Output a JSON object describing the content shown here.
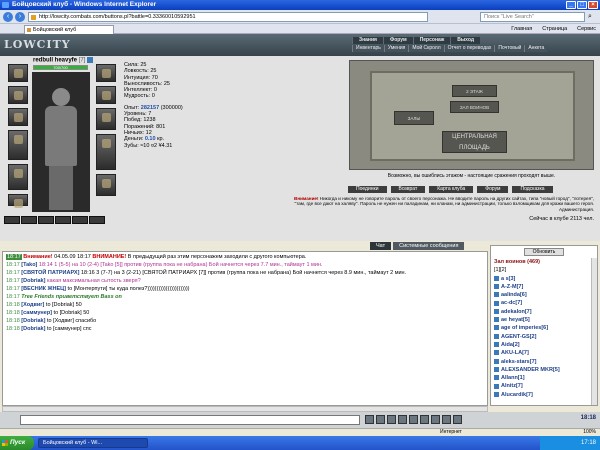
{
  "window": {
    "title": "Бойцовский клуб - Windows Internet Explorer"
  },
  "address": {
    "url": "http://lowcity.combats.com/buttons.pl?battle=0.33360010592951",
    "search_placeholder": "Поиск \"Live Search\""
  },
  "tab": {
    "title": "Бойцовский клуб"
  },
  "toolbar": {
    "home": "Главная",
    "page": "Страница",
    "service": "Сервис"
  },
  "game": {
    "logo": "LOWCITY",
    "topnav": [
      "Знания",
      "Форум",
      "Персонаж",
      "Выход"
    ],
    "subnav": [
      "Инвентарь",
      "Умения",
      "Мой Скролл",
      "Отчет о переводах",
      "Почтовый",
      "Анкета"
    ]
  },
  "character": {
    "name": "redbull heavyfe",
    "level": "[7]",
    "hp": "700/700",
    "hp_fraction": 1.0,
    "stats": [
      {
        "label": "Сила:",
        "value": "25"
      },
      {
        "label": "Ловкость:",
        "value": "25"
      },
      {
        "label": "Интуиция:",
        "value": "70"
      },
      {
        "label": "Выносливость:",
        "value": "25"
      },
      {
        "label": "Интеллект:",
        "value": "0"
      },
      {
        "label": "Мудрость:",
        "value": "0"
      }
    ],
    "exp_label": "Опыт:",
    "exp_value": "282157",
    "exp_next": "(300000)",
    "records": [
      {
        "label": "Уровень:",
        "value": "7"
      },
      {
        "label": "Побед:",
        "value": "1238"
      },
      {
        "label": "Поражений:",
        "value": "801"
      },
      {
        "label": "Ничьих:",
        "value": "12"
      }
    ],
    "money_label": "Деньги:",
    "money_value": "0.10",
    "money_unit": "кр.",
    "teeth": "Зубы: ≈10 ¤2 ¥4.31"
  },
  "location": {
    "rooms": [
      "2 ЭТАЖ",
      "ЗАЛ ВОИНОВ",
      "ЗАЛЫ",
      "ЦЕНТРАЛЬНАЯ ПЛОЩАДЬ"
    ],
    "caption": "Возможно, вы ошиблись этажом - настоящие сражения проходят выше."
  },
  "actions": [
    "Поединки",
    "Возврат",
    "Карта клуба",
    "Форум",
    "Подсказка"
  ],
  "warning": {
    "title": "Внимание!",
    "text1": "Никогда и никому не говорите пароль от своего персонажа. Не вводите пароль на других сайтах, типа \"новый город\", \"лотерея\",",
    "text2": "\"там, где все дают на халяву\". Пароль не нужен ни паладинам, ни кланам, ни администрации, только взломщикам для кражи вашего героя.",
    "text3": "Администрация."
  },
  "online": {
    "text": "Сейчас в клубе 2113 чел."
  },
  "chat": {
    "tabs": [
      "Чат",
      "Системные сообщения"
    ],
    "lines": [
      {
        "time": "18:17",
        "pre": "Внимание!",
        "date": " 04.05.09 18:17 ",
        "bold": "ВНИМАНИЕ!",
        "text": " В предыдущий раз этим персонажем заходили с другого компьютера."
      },
      {
        "time": "18:17",
        "nick": "[Tako]",
        "text": " 18:14 1 (5-5) на 10 (2-4) [Tako [5]] против (группа пока не набрана) Бой начнется через 7.7 мин., таймаут 1 мин."
      },
      {
        "time": "18:17",
        "nick": "[СВЯТОЙ ПАТРИАРХ]",
        "text": " 18:16 3 (7-7) на 3 (2-21) [СВЯТОЙ ПАТРИАРХ [7]] против (группа пока не набрана) Бой начнется через 8.9 мин., таймаут 2 мин."
      },
      {
        "time": "18:17",
        "nick": "[Dobriak]",
        "text": " какая максимальная сытость зверя?"
      },
      {
        "time": "18:17",
        "nick": "[ВЕСНИК ЖНЕЦ]",
        "text": " to [Монтерпути] ты куда полез?)))))))))))))))))))))))"
      },
      {
        "time": "18:17",
        "nick": "Tree Friends",
        "text": " приветствует Bass on"
      },
      {
        "time": "18:18",
        "nick": "[Ходвиг]",
        "text": " to [Dobriak] 50"
      },
      {
        "time": "18:18",
        "nick": "[саммунер]",
        "text": " to [Dobriak] 50"
      },
      {
        "time": "18:18",
        "nick": "[Dobriak]",
        "text": " to [Ходвиг] спасибо"
      },
      {
        "time": "18:18",
        "nick": "[Dobriak]",
        "text": " to [саммунер] спс"
      }
    ]
  },
  "players": {
    "refresh": "Обновить",
    "title": "Зал воинов (469)",
    "pages": "[1][2]",
    "list": [
      "a s[3]",
      "A-Z-M[7]",
      "aalinda[6]",
      "ac-dc[7]",
      "adekalon[7]",
      "ae heyat[5]",
      "age of imperies[6]",
      "AGENT-GS[2]",
      "Aida[2]",
      "AKU-LA[7]",
      "aleks-stars[7]",
      "ALEXSANDER MKR[5]",
      "Allann[1]",
      "Alnitz[7]",
      "Alucardik[7]"
    ]
  },
  "bottom": {
    "clock": "18:18"
  },
  "status": {
    "zone": "Интернет",
    "zoom": "100%"
  },
  "taskbar": {
    "start": "Пуск",
    "item": "Бойцовский клуб - Wi...",
    "time": "17:18"
  }
}
